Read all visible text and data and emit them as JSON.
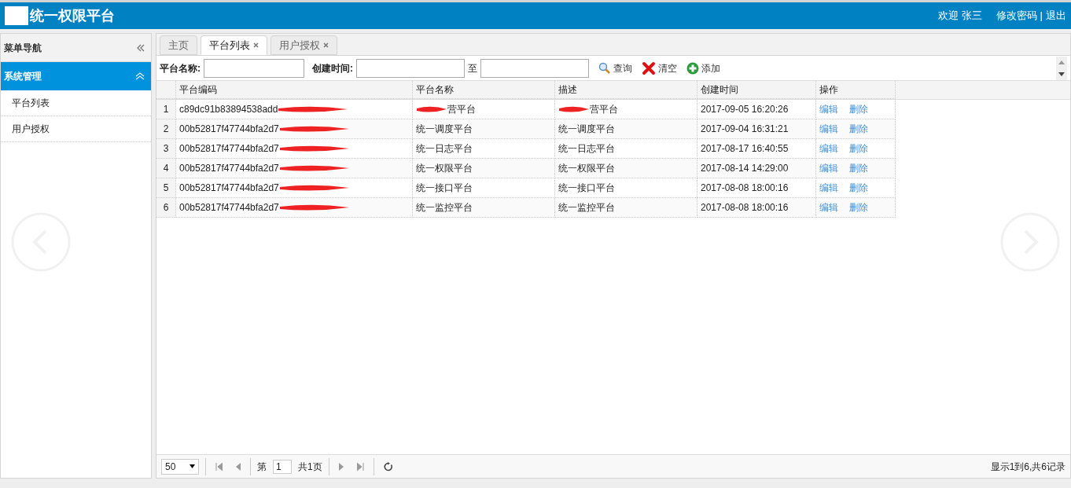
{
  "header": {
    "title": "统一权限平台",
    "welcome": "欢迎",
    "user": "张三",
    "links": [
      "修改密码",
      "退出"
    ],
    "separator": "|"
  },
  "sidebar": {
    "title": "菜单导航",
    "group": {
      "label": "系统管理",
      "expanded": true,
      "items": [
        {
          "label": "平台列表",
          "selected": false
        },
        {
          "label": "用户授权",
          "selected": false
        }
      ]
    }
  },
  "tabs": [
    {
      "label": "主页",
      "selected": false,
      "closable": false
    },
    {
      "label": "平台列表",
      "selected": true,
      "closable": true
    },
    {
      "label": "用户授权",
      "selected": false,
      "closable": true
    }
  ],
  "search": {
    "name_label": "平台名称:",
    "time_label": "创建时间:",
    "to": "至",
    "buttons": [
      {
        "kind": "search",
        "label": "查询"
      },
      {
        "kind": "clear",
        "label": "清空"
      },
      {
        "kind": "add",
        "label": "添加"
      }
    ]
  },
  "table": {
    "columns": [
      "平台编码",
      "平台名称",
      "描述",
      "创建时间",
      "操作"
    ],
    "rows": [
      {
        "index": "1",
        "code": "c89dc91b83894538add",
        "name": "营平台",
        "desc": "营平台",
        "time": "2017-09-05 16:20:26",
        "redacted_name": true,
        "redacted_desc": true,
        "actions": [
          "编辑",
          "删除"
        ]
      },
      {
        "index": "2",
        "code": "00b52817f47744bfa2d7",
        "name": "统一调度平台",
        "desc": "统一调度平台",
        "time": "2017-09-04 16:31:21",
        "redacted_name": false,
        "redacted_desc": false,
        "actions": [
          "编辑",
          "删除"
        ]
      },
      {
        "index": "3",
        "code": "00b52817f47744bfa2d7",
        "name": "统一日志平台",
        "desc": "统一日志平台",
        "time": "2017-08-17 16:40:55",
        "redacted_name": false,
        "redacted_desc": false,
        "actions": [
          "编辑",
          "删除"
        ]
      },
      {
        "index": "4",
        "code": "00b52817f47744bfa2d7",
        "name": "统一权限平台",
        "desc": "统一权限平台",
        "time": "2017-08-14 14:29:00",
        "redacted_name": false,
        "redacted_desc": false,
        "actions": [
          "编辑",
          "删除"
        ]
      },
      {
        "index": "5",
        "code": "00b52817f47744bfa2d7",
        "name": "统一接口平台",
        "desc": "统一接口平台",
        "time": "2017-08-08 18:00:16",
        "redacted_name": false,
        "redacted_desc": false,
        "actions": [
          "编辑",
          "删除"
        ]
      },
      {
        "index": "6",
        "code": "00b52817f47744bfa2d7",
        "name": "统一监控平台",
        "desc": "统一监控平台",
        "time": "2017-08-08 18:00:16",
        "redacted_name": false,
        "redacted_desc": false,
        "actions": [
          "编辑",
          "删除"
        ]
      }
    ]
  },
  "pager": {
    "page_size": "50",
    "page_prefix": "第",
    "page": "1",
    "page_suffix": "共1页",
    "summary": "显示1到6,共6记录"
  }
}
